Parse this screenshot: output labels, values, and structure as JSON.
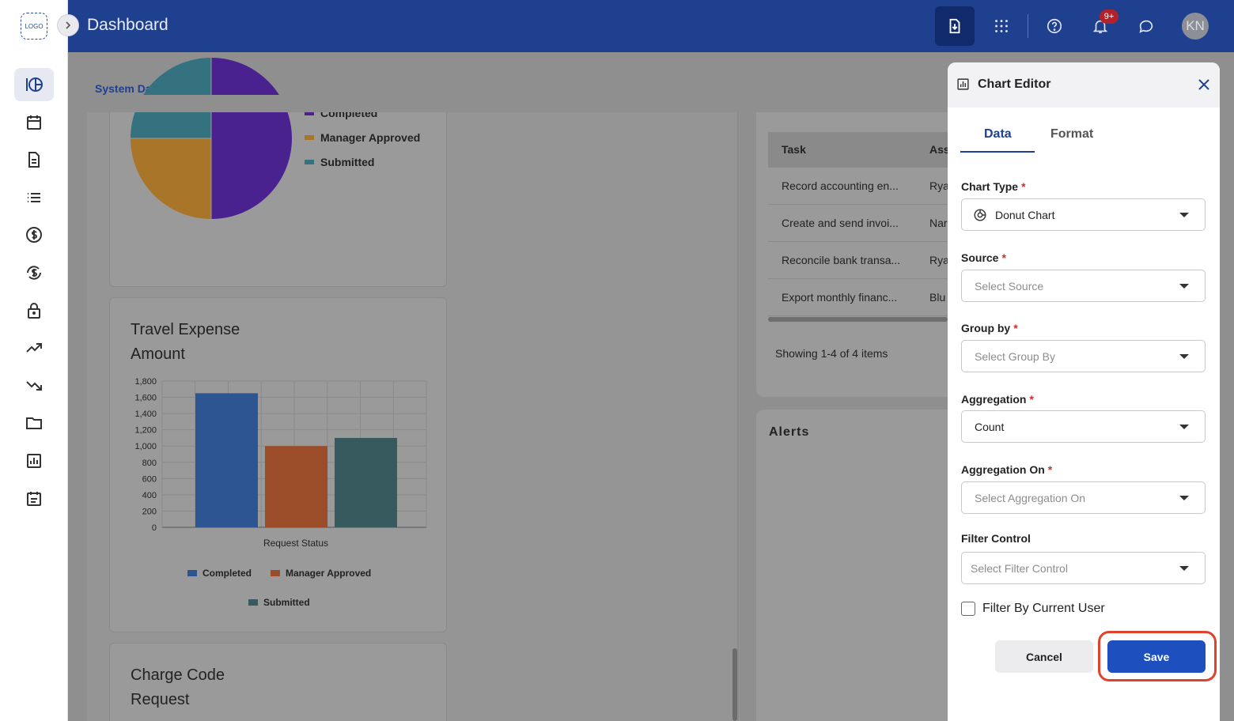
{
  "app": {
    "logo_text": "LOGO",
    "title": "Dashboard",
    "avatar_initials": "KN",
    "notification_badge": "9+"
  },
  "rail": {
    "items": [
      "dashboard-icon",
      "calendar-icon",
      "document-icon",
      "list-icon",
      "dollar-icon",
      "exchange-icon",
      "lock-icon",
      "trending-up-icon",
      "trending-down-icon",
      "folder-icon",
      "report-icon",
      "schedule-icon"
    ]
  },
  "header": {
    "icons": [
      "download-icon",
      "apps-grid-icon",
      "help-icon",
      "bell-icon",
      "chat-icon"
    ]
  },
  "dashboard": {
    "selector_label": "System Dashboard"
  },
  "pie_card": {
    "legend": [
      "Completed",
      "Manager Approved",
      "Submitted"
    ]
  },
  "travel_card": {
    "title": "Travel Expense Amount"
  },
  "charge_card": {
    "title": "Charge Code Request"
  },
  "chart_data": {
    "type": "bar",
    "title": "Travel Expense Amount",
    "categories": [
      "Completed",
      "Manager Approved",
      "Submitted"
    ],
    "values": [
      1650,
      1000,
      1100
    ],
    "xlabel": "Request Status",
    "ylabel": "",
    "ylim": [
      0,
      1800
    ],
    "yticks": [
      "0",
      "200",
      "400",
      "600",
      "800",
      "1,000",
      "1,200",
      "1,400",
      "1,600",
      "1,800"
    ],
    "grid": true,
    "legend": [
      "Completed",
      "Manager Approved",
      "Submitted"
    ],
    "colors": [
      "#2c5592",
      "#9a4d28",
      "#365a5d"
    ]
  },
  "pie_chart": {
    "type": "pie",
    "colors": {
      "completed": "#4a2290",
      "manager_approved": "#a97528",
      "submitted": "#35727f"
    }
  },
  "task_table": {
    "headers": [
      "Task",
      "Ass"
    ],
    "rows": [
      [
        "Record accounting en...",
        "Rya"
      ],
      [
        "Create and send invoi...",
        "Nar"
      ],
      [
        "Reconcile bank transa...",
        "Rya"
      ],
      [
        "Export monthly financ...",
        "Blu"
      ]
    ],
    "footer": "Showing 1-4 of 4 items"
  },
  "alerts": {
    "title": "Alerts"
  },
  "editor": {
    "title": "Chart Editor",
    "tabs": [
      "Data",
      "Format"
    ],
    "fields": {
      "chart_type": {
        "label": "Chart Type",
        "value": "Donut Chart"
      },
      "source": {
        "label": "Source",
        "placeholder": "Select Source"
      },
      "group_by": {
        "label": "Group by",
        "placeholder": "Select Group By"
      },
      "aggregation": {
        "label": "Aggregation",
        "value": "Count"
      },
      "aggregation_on": {
        "label": "Aggregation On",
        "placeholder": "Select Aggregation On"
      },
      "filter_control": {
        "label": "Filter Control",
        "placeholder": "Select Filter Control"
      }
    },
    "required_marker": "*",
    "checkbox_label": "Filter By Current User",
    "cancel_label": "Cancel",
    "save_label": "Save"
  },
  "colors": {
    "brand": "#1f3f8f",
    "primary_button": "#1d4fbf",
    "highlight": "#e0432c"
  }
}
